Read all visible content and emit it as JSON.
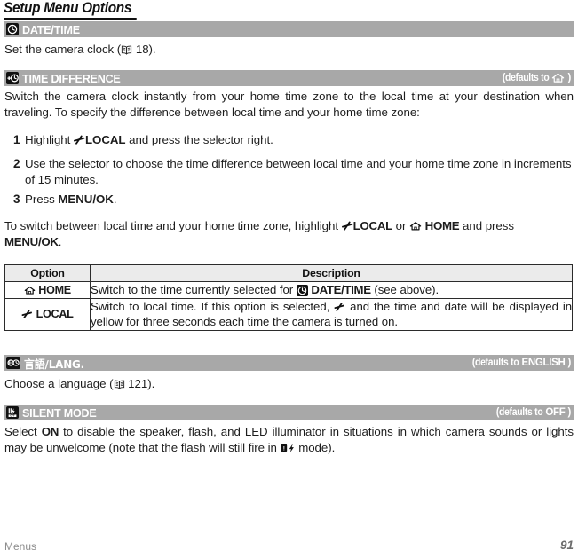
{
  "document": {
    "title": "Setup Menu Options",
    "footer_section": "Menus",
    "page_number": "91"
  },
  "sections": [
    {
      "id": "date-time",
      "icon": "clock-icon",
      "heading": "DATE/TIME",
      "default_label": "",
      "default_value": "",
      "body": "Set the camera clock (",
      "body_page_ref": "18",
      "body_tail": ")."
    },
    {
      "id": "time-difference",
      "icon": "time-difference-icon",
      "heading": "TIME DIFFERENCE",
      "default_label": "(defaults to",
      "default_value": "home-icon",
      "default_close": ")"
    },
    {
      "id": "language",
      "icon": "globe-language-icon",
      "heading": "言語/LANG.",
      "default_label": "(defaults to",
      "default_value": "ENGLISH",
      "default_close": ")",
      "body_lead": "Choose a language (",
      "body_page_ref": "121",
      "body_tail": ")."
    },
    {
      "id": "silent-mode",
      "icon": "silent-mode-icon",
      "heading": "SILENT MODE",
      "default_label": "(defaults to",
      "default_value": "OFF",
      "default_close": ")"
    }
  ],
  "time_difference": {
    "intro": "Switch the camera clock instantly from your home time zone to the local time at your destination when traveling.  To specify the difference between local time and your home time zone:",
    "steps": [
      {
        "num": "1",
        "lead": "Highlight",
        "icon": "local-airplane-icon",
        "bold": "LOCAL",
        "tail": "and press the selector right."
      },
      {
        "num": "2",
        "text": "Use the selector to choose the time difference between local time and your home time zone in increments of 15 minutes."
      },
      {
        "num": "3",
        "lead": "Press",
        "bold": "MENU/OK",
        "tail": "."
      }
    ],
    "closing": {
      "lead": "To switch between local time and your home time zone, highlight",
      "icon_local": "local-airplane-icon",
      "bold_local": "LOCAL",
      "mid": "or",
      "icon_home": "home-icon",
      "bold_home": "HOME",
      "tail": "and press",
      "bold_menu": "MENU/OK",
      "period": "."
    },
    "table": {
      "headers": [
        "Option",
        "Description"
      ],
      "rows": [
        {
          "option_icon": "home-icon",
          "option_label": "HOME",
          "desc_lead": "Switch to the time currently selected for",
          "desc_icon": "clock-icon",
          "desc_bold": "DATE/TIME",
          "desc_tail": "(see above)."
        },
        {
          "option_icon": "local-airplane-icon",
          "option_label": "LOCAL",
          "desc_lead": "Switch to local time.  If this option is selected,",
          "desc_icon": "local-airplane-icon",
          "desc_tail": "and the time and date will be displayed in yellow for three seconds each time the camera is turned on."
        }
      ]
    }
  },
  "silent_mode": {
    "lead": "Select",
    "bold_on": "ON",
    "mid": "to disable the speaker, flash, and LED illuminator in situations in which camera sounds or lights may be unwelcome (note that the flash will still fire in",
    "icon": "forced-flash-icon",
    "tail": "mode)."
  },
  "colors": {
    "bar_background": "#a8a8a8",
    "bar_text": "#ffffff",
    "table_header_background": "#ebebeb",
    "body_text": "#1d1d1d",
    "footer_text": "#8c8c8c",
    "rule": "#9a9a9a"
  }
}
